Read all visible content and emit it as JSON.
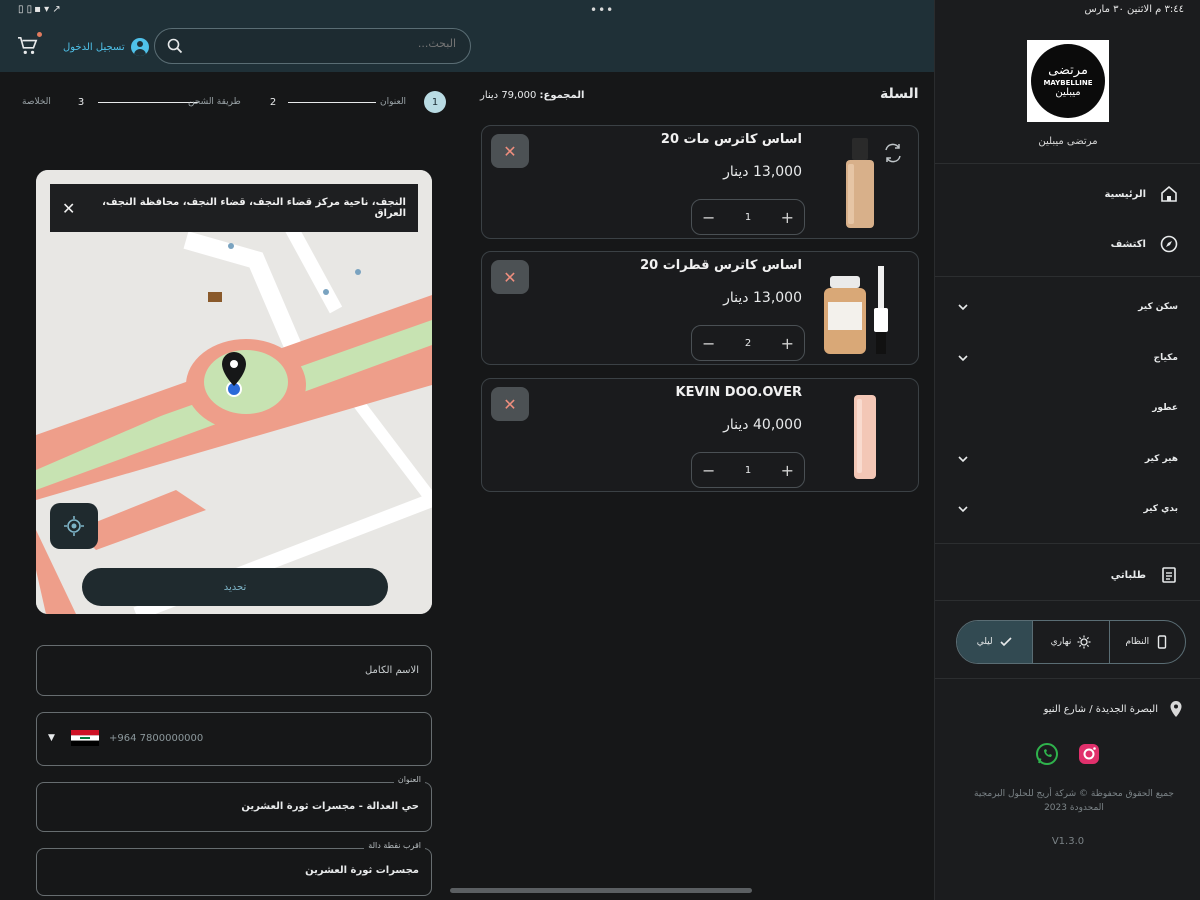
{
  "status": {
    "left": " ▯ ▯ ▪ ▾ ↗",
    "dots": "•••",
    "right": "٣:٤٤ م   الاثنين ٣٠ مارس"
  },
  "header": {
    "login_label": "تسجيل الدخول",
    "search_placeholder": "البحث..."
  },
  "sidebar": {
    "brand_logo_text": [
      "مرتضى",
      "MAYBELLINE",
      "ميبلين"
    ],
    "brand_name": "مرتضى ميبلين",
    "nav": [
      {
        "label": "الرئيسية",
        "icon": "home-icon"
      },
      {
        "label": "اكتشف",
        "icon": "compass-icon"
      }
    ],
    "categories": [
      "سكن كير",
      "مكياج",
      "عطور",
      "هير كير",
      "بدي كير"
    ],
    "orders_label": "طلباتي",
    "theme": {
      "system": "النظام",
      "light": "نهاري",
      "dark": "ليلي",
      "selected": "dark"
    },
    "address": "البصرة الجديدة / شارع النيو",
    "copyright": "جميع الحقوق محفوظة © شركة أريج للحلول البرمجية المحدودة 2023",
    "version": "V1.3.0",
    "colors": {
      "whatsapp": "#2fb24c",
      "instagram": "#e1306c"
    }
  },
  "cart": {
    "title": "السلة",
    "total_label": "المجموع:",
    "total_value": "79,000 دينار",
    "items": [
      {
        "name": "اساس كاترس مات 20",
        "price": "13,000 دينار",
        "qty": "1"
      },
      {
        "name": "اساس كاترس قطرات 20",
        "price": "13,000 دينار",
        "qty": "2"
      },
      {
        "name": "KEVIN DOO.OVER",
        "price": "40,000 دينار",
        "qty": "1"
      }
    ]
  },
  "checkout": {
    "steps": [
      {
        "num": "1",
        "label": "العنوان"
      },
      {
        "num": "2",
        "label": "طريقة الشحن"
      },
      {
        "num": "3",
        "label": "الخلاصة"
      }
    ],
    "current_step": 1,
    "map_banner": "النجف، ناحية مركز قضاء النجف، قضاء النجف، محافظة النجف، العراق",
    "confirm_label": "تحديد",
    "full_name_placeholder": "الاسم الكامل",
    "phone_placeholder": "+964 7800000000",
    "address_label": "العنوان",
    "address_value": "حي العدالة - مجسرات ثورة العشرين",
    "landmark_label": "اقرب نقطة دالة",
    "landmark_value": "مجسرات ثورة العشرين"
  }
}
